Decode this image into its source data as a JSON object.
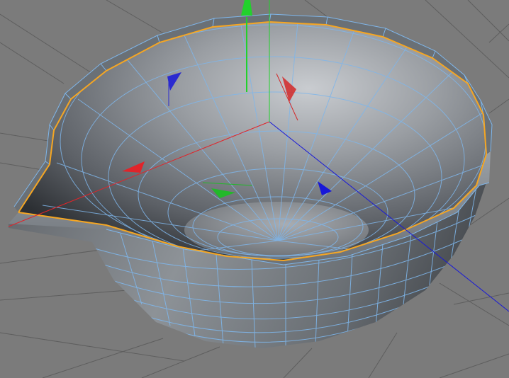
{
  "viewport": {
    "background": "#7b7b7b",
    "grid_color": "#5e5e5e",
    "object": {
      "name": "bowl",
      "mesh_color": "#8a9199",
      "wireframe_color": "#7fb6ea",
      "selected_edge_color": "#f5a623"
    },
    "gizmo": {
      "x_axis_color": "#e0242a",
      "y_axis_color": "#22d12c",
      "z_axis_color": "#1818d8",
      "handles": [
        "x-arrow",
        "y-arrow",
        "z-arrow",
        "xy-plane",
        "yz-plane",
        "xz-plane"
      ]
    }
  }
}
